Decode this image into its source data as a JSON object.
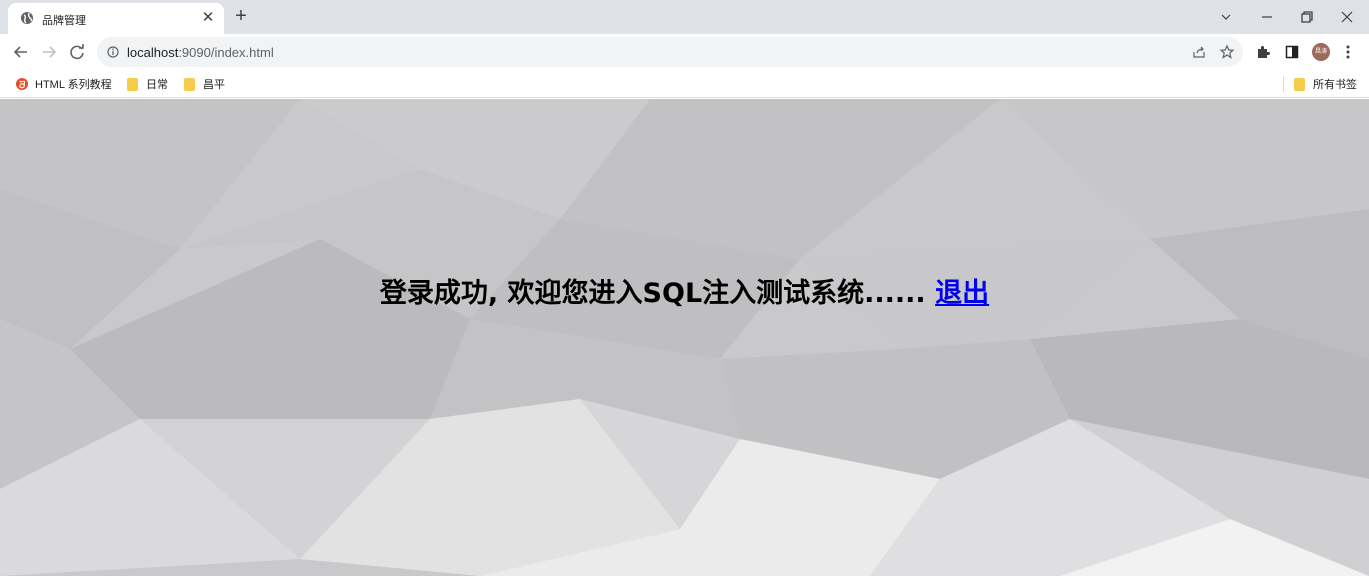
{
  "browser": {
    "tab": {
      "title": "品牌管理"
    },
    "new_tab_label": "+",
    "address": {
      "host": "localhost",
      "path": ":9090/index.html"
    },
    "profile": {
      "initials": "昌涛"
    }
  },
  "bookmarks": {
    "items": [
      {
        "label": "HTML 系列教程",
        "icon": "html5-icon"
      },
      {
        "label": "日常",
        "icon": "folder-icon"
      },
      {
        "label": "昌平",
        "icon": "folder-icon"
      }
    ],
    "all_bookmarks_label": "所有书签"
  },
  "page": {
    "message": "登录成功, 欢迎您进入SQL注入测试系统......",
    "logout_link": "退出"
  },
  "colors": {
    "link": "#0000ee",
    "folder": "#f9cb4a",
    "tabstrip": "#dee1e6"
  }
}
